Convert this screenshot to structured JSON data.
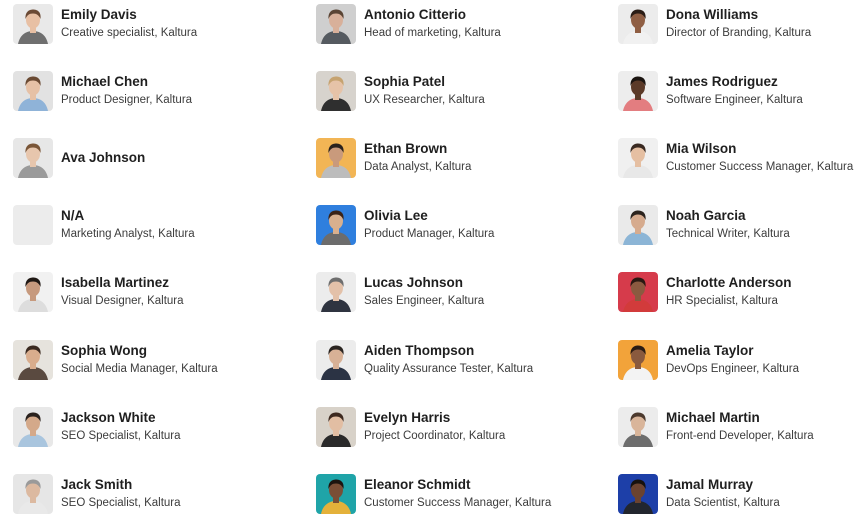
{
  "people": [
    {
      "name": "Emily Davis",
      "role": "Creative specialist, Kaltura",
      "avatar": "person-photo",
      "bg": "#e9e9e9",
      "skin": "#e8c0a4",
      "hair": "#6b4a35",
      "shirt": "#6f6f6f"
    },
    {
      "name": "Antonio Citterio",
      "role": "Head of marketing, Kaltura",
      "avatar": "person-photo",
      "bg": "#cfcfcf",
      "skin": "#d8b09a",
      "hair": "#5a4434",
      "shirt": "#555a60"
    },
    {
      "name": "Dona Williams",
      "role": "Director of Branding, Kaltura",
      "avatar": "person-photo",
      "bg": "#ececec",
      "skin": "#8f5e43",
      "hair": "#2b1d16",
      "shirt": "#f1f1f1"
    },
    {
      "name": "Michael Chen",
      "role": "Product Designer, Kaltura",
      "avatar": "person-photo",
      "bg": "#e2e2e2",
      "skin": "#e6c1a6",
      "hair": "#6a4a33",
      "shirt": "#8fb3d8"
    },
    {
      "name": "Sophia Patel",
      "role": "UX Researcher, Kaltura",
      "avatar": "person-photo",
      "bg": "#d7d3cd",
      "skin": "#e6c3a8",
      "hair": "#c6a370",
      "shirt": "#2f2f2f"
    },
    {
      "name": "James Rodriguez",
      "role": "Software Engineer, Kaltura",
      "avatar": "person-photo",
      "bg": "#ededed",
      "skin": "#5b3a28",
      "hair": "#1a1410",
      "shirt": "#e37d80"
    },
    {
      "name": "Ava Johnson",
      "role": "",
      "avatar": "person-photo",
      "bg": "#e7e7e7",
      "skin": "#e7c6ad",
      "hair": "#7a5638",
      "shirt": "#9a9a9a"
    },
    {
      "name": "Ethan Brown",
      "role": "Data Analyst, Kaltura",
      "avatar": "person-photo",
      "bg": "#f2b555",
      "skin": "#c99a7c",
      "hair": "#2a221d",
      "shirt": "#bcbcbc"
    },
    {
      "name": "Mia Wilson",
      "role": "Customer Success Manager, Kaltura",
      "avatar": "person-photo",
      "bg": "#f0f0f0",
      "skin": "#e5bfa2",
      "hair": "#3a2a22",
      "shirt": "#e8e8e8"
    },
    {
      "name": "N/A",
      "role": "Marketing Analyst, Kaltura",
      "avatar": "empty",
      "bg": "#ececec",
      "skin": "",
      "hair": "",
      "shirt": ""
    },
    {
      "name": "Olivia Lee",
      "role": "Product Manager, Kaltura",
      "avatar": "person-photo",
      "bg": "#2f7fde",
      "skin": "#d9b08e",
      "hair": "#3b2316",
      "shirt": "#6c6c6c"
    },
    {
      "name": "Noah Garcia",
      "role": "Technical Writer, Kaltura",
      "avatar": "person-photo",
      "bg": "#eaeaea",
      "skin": "#d6ab8e",
      "hair": "#2c241e",
      "shirt": "#8cb5d6"
    },
    {
      "name": "Isabella Martinez",
      "role": "Visual Designer, Kaltura",
      "avatar": "person-photo",
      "bg": "#f1f1f1",
      "skin": "#c79a7e",
      "hair": "#1f1814",
      "shirt": "#dddddd"
    },
    {
      "name": "Lucas Johnson",
      "role": "Sales Engineer, Kaltura",
      "avatar": "person-photo",
      "bg": "#ececec",
      "skin": "#e3c1a9",
      "hair": "#6e6e6e",
      "shirt": "#2f3440"
    },
    {
      "name": "Charlotte Anderson",
      "role": "HR Specialist, Kaltura",
      "avatar": "person-photo",
      "bg": "#d63b4b",
      "skin": "#8b5a40",
      "hair": "#2a1812",
      "shirt": "#d23b3b"
    },
    {
      "name": "Sophia Wong",
      "role": "Social Media Manager, Kaltura",
      "avatar": "person-photo",
      "bg": "#e6e3dd",
      "skin": "#d9ad8d",
      "hair": "#3b2a20",
      "shirt": "#5a4a40"
    },
    {
      "name": "Aiden Thompson",
      "role": "Quality Assurance Tester, Kaltura",
      "avatar": "person-photo",
      "bg": "#ececec",
      "skin": "#d8b196",
      "hair": "#2a2420",
      "shirt": "#2b3344"
    },
    {
      "name": "Amelia Taylor",
      "role": "DevOps Engineer, Kaltura",
      "avatar": "person-photo",
      "bg": "#f2a33a",
      "skin": "#8a5a3e",
      "hair": "#2a1c14",
      "shirt": "#f3f3f3"
    },
    {
      "name": "Jackson White",
      "role": "SEO Specialist, Kaltura",
      "avatar": "person-photo",
      "bg": "#e8e8e8",
      "skin": "#d4a98a",
      "hair": "#2a221e",
      "shirt": "#a9c5de"
    },
    {
      "name": "Evelyn Harris",
      "role": "Project Coordinator, Kaltura",
      "avatar": "person-photo",
      "bg": "#d8d2c9",
      "skin": "#e2bea3",
      "hair": "#3e2a20",
      "shirt": "#2a2a2a"
    },
    {
      "name": "Michael Martin",
      "role": "Front-end Developer, Kaltura",
      "avatar": "person-photo",
      "bg": "#ececec",
      "skin": "#d9b59a",
      "hair": "#4c3a2e",
      "shirt": "#6d6d6d"
    },
    {
      "name": "Jack Smith",
      "role": "SEO Specialist, Kaltura",
      "avatar": "person-photo",
      "bg": "#e6e6e6",
      "skin": "#dcb9a0",
      "hair": "#9a9a9a",
      "shirt": "#e9e9e9"
    },
    {
      "name": "Eleanor Schmidt",
      "role": "Customer Success Manager, Kaltura",
      "avatar": "person-photo",
      "bg": "#1fa4a8",
      "skin": "#7a4e36",
      "hair": "#1c140f",
      "shirt": "#e4b13a"
    },
    {
      "name": "Jamal Murray",
      "role": "Data Scientist, Kaltura",
      "avatar": "person-photo",
      "bg": "#1d3fa8",
      "skin": "#6b4330",
      "hair": "#16110e",
      "shirt": "#22262e"
    }
  ]
}
